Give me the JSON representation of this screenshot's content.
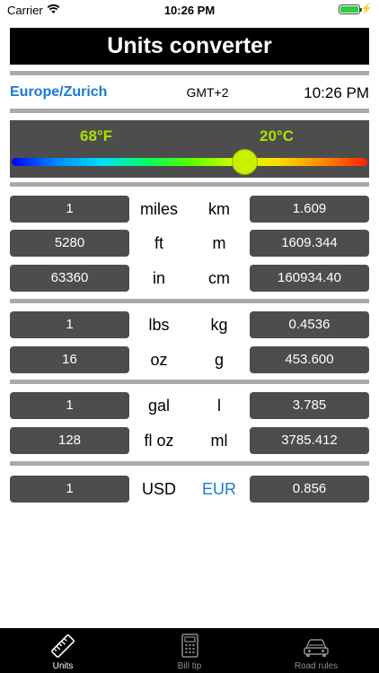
{
  "status_bar": {
    "carrier": "Carrier",
    "time": "10:26 PM",
    "charging_icon": "bolt-icon"
  },
  "header": {
    "title": "Units converter"
  },
  "timezone": {
    "name": "Europe/Zurich",
    "offset": "GMT+2",
    "local_time": "10:26 PM"
  },
  "temperature": {
    "fahrenheit": "68°F",
    "celsius": "20°C",
    "slider_fraction": 0.655
  },
  "length": [
    {
      "from_value": "1",
      "from_unit": "miles",
      "to_unit": "km",
      "to_value": "1.609"
    },
    {
      "from_value": "5280",
      "from_unit": "ft",
      "to_unit": "m",
      "to_value": "1609.344"
    },
    {
      "from_value": "63360",
      "from_unit": "in",
      "to_unit": "cm",
      "to_value": "160934.40"
    }
  ],
  "weight": [
    {
      "from_value": "1",
      "from_unit": "lbs",
      "to_unit": "kg",
      "to_value": "0.4536"
    },
    {
      "from_value": "16",
      "from_unit": "oz",
      "to_unit": "g",
      "to_value": "453.600"
    }
  ],
  "volume": [
    {
      "from_value": "1",
      "from_unit": "gal",
      "to_unit": "l",
      "to_value": "3.785"
    },
    {
      "from_value": "128",
      "from_unit": "fl oz",
      "to_unit": "ml",
      "to_value": "3785.412"
    }
  ],
  "currency": [
    {
      "from_value": "1",
      "from_unit": "USD",
      "to_unit": "EUR",
      "to_value": "0.856"
    }
  ],
  "tabs": [
    {
      "label": "Units",
      "icon": "ruler-icon",
      "active": true
    },
    {
      "label": "Bill tip",
      "icon": "calculator-icon",
      "active": false
    },
    {
      "label": "Road rules",
      "icon": "car-icon",
      "active": false
    }
  ],
  "colors": {
    "accent": "#1a7ad6",
    "panel": "#4d4d4d",
    "temperature_label": "#a9e300",
    "divider": "#a9a9a9"
  }
}
